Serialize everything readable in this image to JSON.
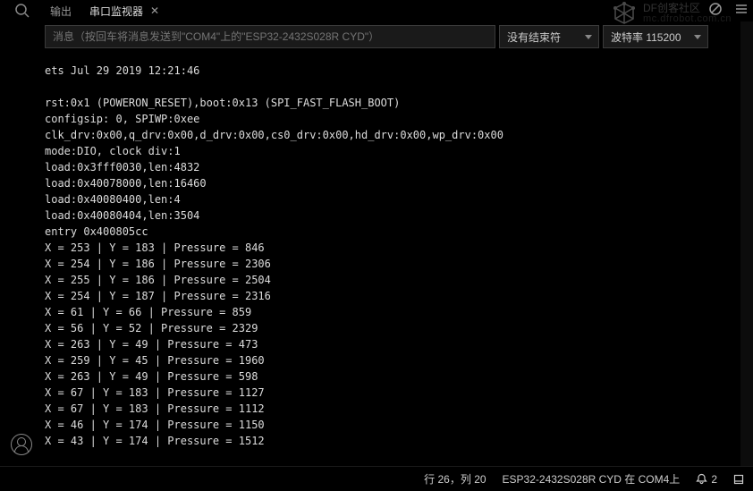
{
  "watermark": {
    "brand": "DF创客社区",
    "domain": "mc.dfrobot.com.cn"
  },
  "tabs": {
    "output": "输出",
    "serial": "串口监视器"
  },
  "input": {
    "placeholder": "消息（按回车将消息发送到\"COM4\"上的\"ESP32-2432S028R CYD\"）"
  },
  "select_line_ending": "没有结束符",
  "select_baud": "波特率  115200",
  "footer": {
    "cursor": "行 26，列 20",
    "board": "ESP32-2432S028R CYD 在 COM4上",
    "notif_count": "2",
    "notif_icon": "🔔"
  },
  "terminal": "ets Jul 29 2019 12:21:46\n\nrst:0x1 (POWERON_RESET),boot:0x13 (SPI_FAST_FLASH_BOOT)\nconfigsip: 0, SPIWP:0xee\nclk_drv:0x00,q_drv:0x00,d_drv:0x00,cs0_drv:0x00,hd_drv:0x00,wp_drv:0x00\nmode:DIO, clock div:1\nload:0x3fff0030,len:4832\nload:0x40078000,len:16460\nload:0x40080400,len:4\nload:0x40080404,len:3504\nentry 0x400805cc\nX = 253 | Y = 183 | Pressure = 846\nX = 254 | Y = 186 | Pressure = 2306\nX = 255 | Y = 186 | Pressure = 2504\nX = 254 | Y = 187 | Pressure = 2316\nX = 61 | Y = 66 | Pressure = 859\nX = 56 | Y = 52 | Pressure = 2329\nX = 263 | Y = 49 | Pressure = 473\nX = 259 | Y = 45 | Pressure = 1960\nX = 263 | Y = 49 | Pressure = 598\nX = 67 | Y = 183 | Pressure = 1127\nX = 67 | Y = 183 | Pressure = 1112\nX = 46 | Y = 174 | Pressure = 1150\nX = 43 | Y = 174 | Pressure = 1512"
}
